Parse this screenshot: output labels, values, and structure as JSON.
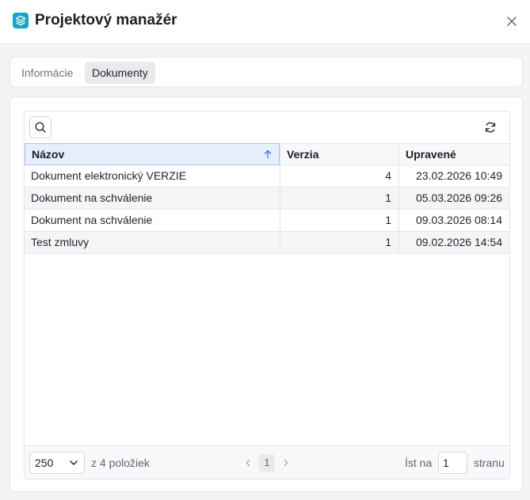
{
  "header": {
    "title": "Projektový manažér",
    "logo_icon": "layers-icon",
    "close_icon": "close-icon",
    "accent_color": "#12a6c4"
  },
  "tabs": [
    {
      "label": "Informácie",
      "active": false
    },
    {
      "label": "Dokumenty",
      "active": true
    }
  ],
  "grid": {
    "search_icon": "search-icon",
    "refresh_icon": "refresh-icon",
    "columns": [
      {
        "label": "Názov",
        "sort": "ascending"
      },
      {
        "label": "Verzia"
      },
      {
        "label": "Upravené"
      }
    ],
    "rows": [
      {
        "name": "Dokument elektronický VERZIE",
        "version": "4",
        "modified": "23.02.2026 10:49"
      },
      {
        "name": "Dokument na schválenie",
        "version": "1",
        "modified": "05.03.2026 09:26"
      },
      {
        "name": "Dokument na schválenie",
        "version": "1",
        "modified": "09.03.2026 08:14"
      },
      {
        "name": "Test zmluvy",
        "version": "1",
        "modified": "09.02.2026 14:54"
      }
    ]
  },
  "footer": {
    "page_size": "250",
    "count_text": "z 4 položiek",
    "current_page": "1",
    "goto_label": "Íst na",
    "goto_value": "1",
    "goto_suffix": "stranu"
  }
}
